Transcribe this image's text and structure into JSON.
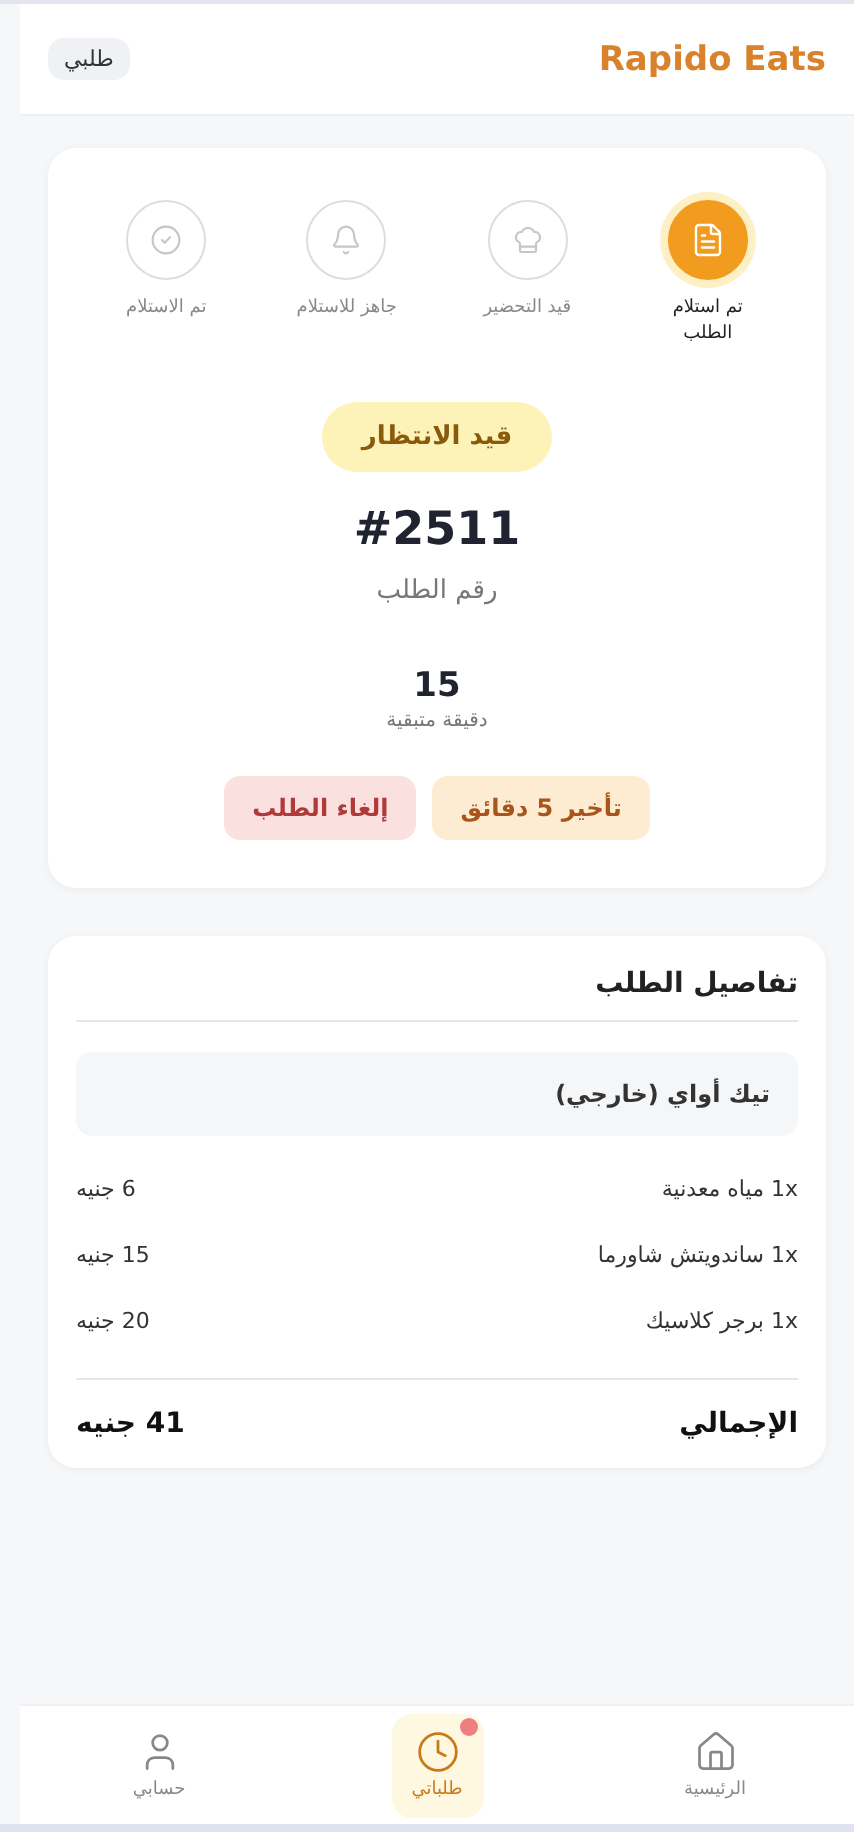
{
  "header": {
    "brand": "Rapido Eats",
    "tag": "طلبي"
  },
  "progress": {
    "steps": [
      {
        "kind": "document",
        "label": "تم استلام الطلب",
        "selected": true
      },
      {
        "kind": "chef",
        "label": "قيد التحضير",
        "selected": false
      },
      {
        "kind": "bell",
        "label": "جاهز للاستلام",
        "selected": false
      },
      {
        "kind": "check",
        "label": "تم الاستلام",
        "selected": false
      }
    ]
  },
  "status": {
    "badge": "قيد الانتظار",
    "order_number": "#2511",
    "order_label": "رقم الطلب",
    "minutes": "15",
    "minutes_label": "دقيقة متبقية"
  },
  "actions": [
    {
      "kind": "delay",
      "label": "تأخير 5 دقائق"
    },
    {
      "kind": "cancel",
      "label": "إلغاء الطلب"
    }
  ],
  "details": {
    "title": "تفاصيل الطلب",
    "order_type": "تيك أواي (خارجي)",
    "items": [
      {
        "name": "1x مياه معدنية",
        "price": "6 جنيه"
      },
      {
        "name": "1x ساندويتش شاورما",
        "price": "15 جنيه"
      },
      {
        "name": "1x برجر كلاسيك",
        "price": "20 جنيه"
      }
    ],
    "total_label": "الإجمالي",
    "total": "41 جنيه"
  },
  "nav": [
    {
      "kind": "home",
      "label": "الرئيسية",
      "selected": false,
      "badge": false
    },
    {
      "kind": "clock",
      "label": "طلباتي",
      "selected": true,
      "badge": true
    },
    {
      "kind": "user",
      "label": "حسابي",
      "selected": false,
      "badge": false
    }
  ]
}
